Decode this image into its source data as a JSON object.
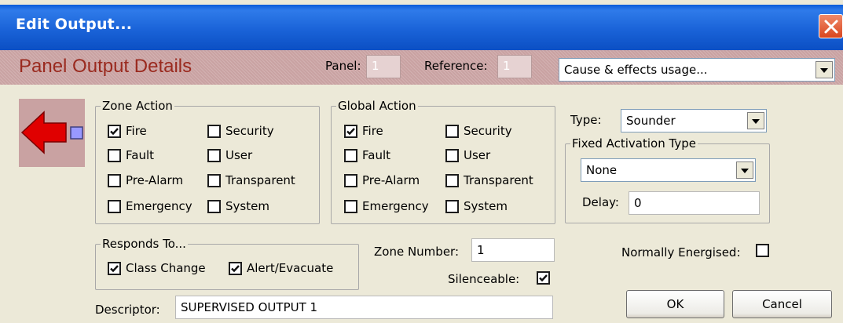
{
  "window": {
    "title": "Edit Output..."
  },
  "header": {
    "title": "Panel Output Details",
    "panel_label": "Panel:",
    "panel_value": "1",
    "reference_label": "Reference:",
    "reference_value": "1",
    "usage_select": "Cause & effects usage..."
  },
  "zone_action": {
    "legend": "Zone Action",
    "fire": {
      "label": "Fire",
      "checked": true
    },
    "security": {
      "label": "Security",
      "checked": false
    },
    "fault": {
      "label": "Fault",
      "checked": false
    },
    "user": {
      "label": "User",
      "checked": false
    },
    "pre_alarm": {
      "label": "Pre-Alarm",
      "checked": false
    },
    "transparent": {
      "label": "Transparent",
      "checked": false
    },
    "emergency": {
      "label": "Emergency",
      "checked": false
    },
    "system": {
      "label": "System",
      "checked": false
    }
  },
  "global_action": {
    "legend": "Global Action",
    "fire": {
      "label": "Fire",
      "checked": true
    },
    "security": {
      "label": "Security",
      "checked": false
    },
    "fault": {
      "label": "Fault",
      "checked": false
    },
    "user": {
      "label": "User",
      "checked": false
    },
    "pre_alarm": {
      "label": "Pre-Alarm",
      "checked": false
    },
    "transparent": {
      "label": "Transparent",
      "checked": false
    },
    "emergency": {
      "label": "Emergency",
      "checked": false
    },
    "system": {
      "label": "System",
      "checked": false
    }
  },
  "type": {
    "label": "Type:",
    "value": "Sounder"
  },
  "fixed_activation": {
    "legend": "Fixed Activation Type",
    "value": "None",
    "delay_label": "Delay:",
    "delay_value": "0"
  },
  "responds_to": {
    "legend": "Responds To...",
    "class_change": {
      "label": "Class Change",
      "checked": true
    },
    "alert_evacuate": {
      "label": "Alert/Evacuate",
      "checked": true
    }
  },
  "zone_number": {
    "label": "Zone Number:",
    "value": "1"
  },
  "silenceable": {
    "label": "Silenceable:",
    "checked": true
  },
  "normally_energised": {
    "label": "Normally Energised:",
    "checked": false
  },
  "descriptor": {
    "label": "Descriptor:",
    "value": "SUPERVISED OUTPUT 1"
  },
  "buttons": {
    "ok": "OK",
    "cancel": "Cancel"
  },
  "colors": {
    "title_bar": "#1a63d8",
    "header_band": "#c9a2a2",
    "header_title": "#9a2a1f",
    "arrow": "#e00000",
    "indicator": "#9999ff"
  },
  "icons": {
    "close": "close-icon",
    "direction": "red-left-arrow-icon",
    "check": "check-icon"
  }
}
